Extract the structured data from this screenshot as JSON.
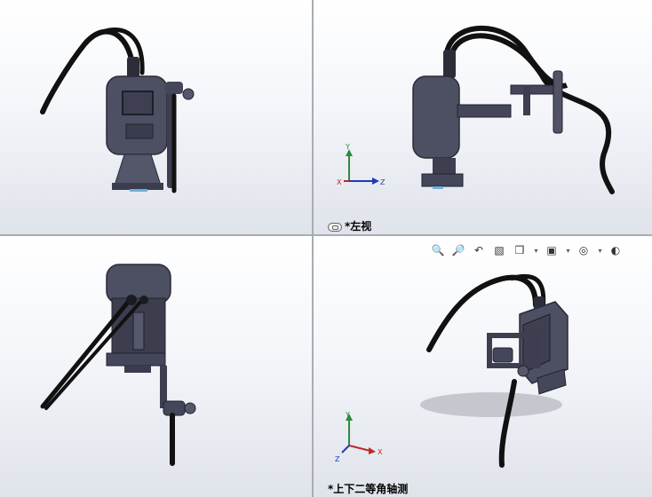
{
  "viewports": {
    "top_right": {
      "label": "*左视"
    },
    "bottom_right": {
      "label": "*上下二等角轴测"
    }
  },
  "triad": {
    "x": "X",
    "y": "Y",
    "z": "Z"
  },
  "toolbar": {
    "icons": [
      "zoom-to-fit-icon",
      "zoom-area-icon",
      "previous-view-icon",
      "section-view-icon",
      "view-orientation-icon",
      "display-style-icon",
      "hide-show-items-icon",
      "edit-appearance-icon",
      "scene-icon"
    ]
  },
  "colors": {
    "model": "#4a4c5e",
    "cable": "#121214",
    "x_axis": "#c0282a",
    "y_axis": "#2e8b3c",
    "z_axis": "#2438b8"
  }
}
